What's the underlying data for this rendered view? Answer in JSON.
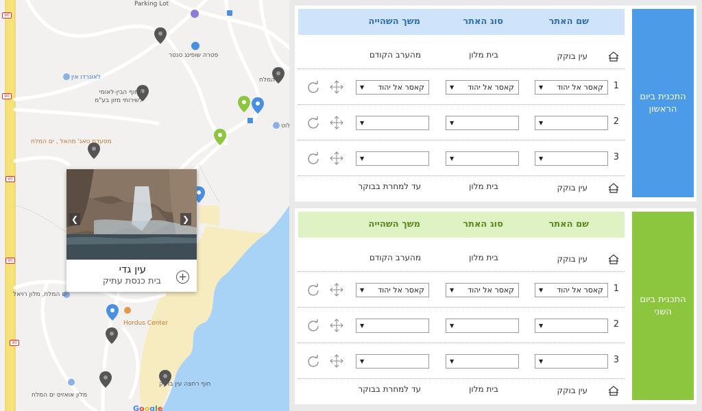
{
  "map": {
    "labels": {
      "parking": "Parking Lot",
      "shopping": "פטרה שופינג סנטר",
      "leonardo": "לאונרדו אין",
      "beach_access": "החוף הבין-לאומי לשירותי מזון בע\"מ",
      "salt_sea": "המלח",
      "restaurant": "מסעדת טאג' מהאל , ים המלח",
      "hotel_royal": "ים המלח, מלון רויאל",
      "hordus": "Hordus Center",
      "oasis": "מלון אואזיס ים המלח",
      "public_beach": "חוף רחצה עין בוקק",
      "lot": "לוט",
      "google": "Google"
    },
    "road_number": "90",
    "popup": {
      "title": "עין גדי",
      "subtitle": "בית כנסת עתיק",
      "prev_arrow": "❮",
      "next_arrow": "❯",
      "add": "+"
    }
  },
  "days": [
    {
      "label": "התכנית ביום הראשון",
      "headers": {
        "name": "שם האתר",
        "type": "סוג האתר",
        "duration": "משך השהייה"
      },
      "start_row": {
        "name": "עין בוקק",
        "type": "בית מלון",
        "duration": "מהערב הקודם"
      },
      "rows": [
        {
          "num": "1",
          "name": "קאסר אל יהוד",
          "type": "קאסר אל יהוד",
          "duration": "קאסר אל יהוד"
        },
        {
          "num": "2",
          "name": "",
          "type": "",
          "duration": ""
        },
        {
          "num": "3",
          "name": "",
          "type": "",
          "duration": ""
        }
      ],
      "end_row": {
        "name": "עין בוקק",
        "type": "בית מלון",
        "duration": "עד למחרת בבוקר"
      }
    },
    {
      "label": "התכנית ביום השני",
      "headers": {
        "name": "שם האתר",
        "type": "סוג האתר",
        "duration": "משך השהייה"
      },
      "start_row": {
        "name": "עין בוקק",
        "type": "בית מלון",
        "duration": "מהערב הקודם"
      },
      "rows": [
        {
          "num": "1",
          "name": "קאסר אל יהוד",
          "type": "קאסר אל יהוד",
          "duration": "קאסר אל יהוד"
        },
        {
          "num": "2",
          "name": "",
          "type": "",
          "duration": ""
        },
        {
          "num": "3",
          "name": "",
          "type": "",
          "duration": ""
        }
      ],
      "end_row": {
        "name": "עין בוקק",
        "type": "בית מלון",
        "duration": "עד למחרת בבוקר"
      }
    }
  ],
  "colors": {
    "day1_accent": "#4b9be8",
    "day2_accent": "#8cc63f",
    "water": "#a9d2f7",
    "sand": "#f7ecc0"
  }
}
